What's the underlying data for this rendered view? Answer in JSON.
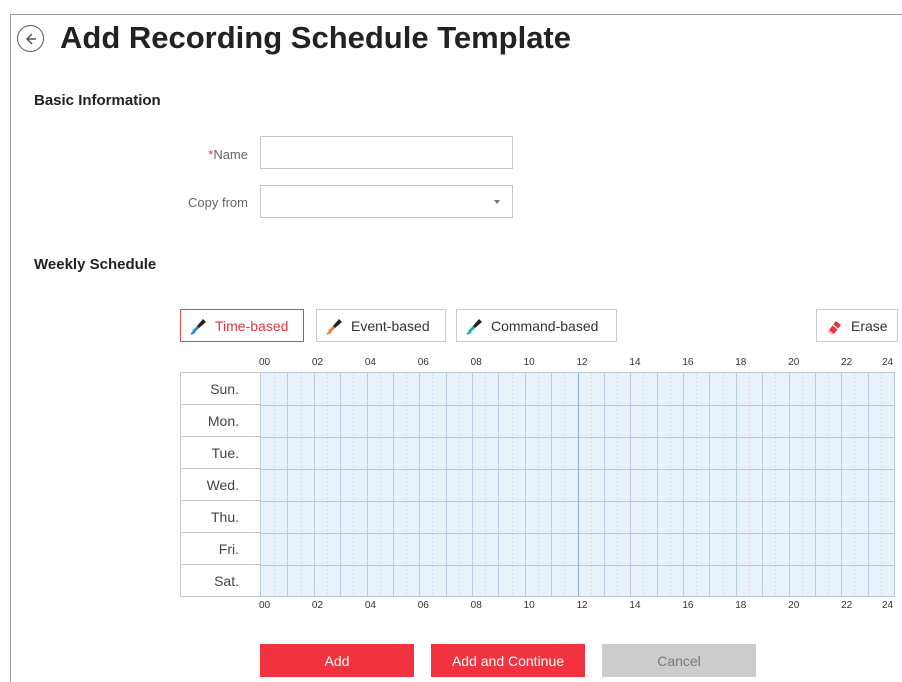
{
  "header": {
    "title": "Add Recording Schedule Template",
    "back_icon": "back-arrow-circle-icon"
  },
  "basic_info": {
    "section_title": "Basic Information",
    "name_required_mark": "*",
    "name_label": "Name",
    "name_value": "",
    "copy_from_label": "Copy from",
    "copy_from_value": ""
  },
  "weekly_schedule": {
    "section_title": "Weekly Schedule",
    "tools": [
      {
        "label": "Time-based",
        "icon": "brush-blue-icon",
        "color": "#1e88c8",
        "active": true
      },
      {
        "label": "Event-based",
        "icon": "brush-orange-icon",
        "color": "#f07a2a",
        "active": false
      },
      {
        "label": "Command-based",
        "icon": "brush-teal-icon",
        "color": "#1fa89a",
        "active": false
      },
      {
        "label": "Erase",
        "icon": "eraser-icon",
        "color": "#e8343f",
        "active": false
      }
    ],
    "hours": [
      "00",
      "02",
      "04",
      "06",
      "08",
      "10",
      "12",
      "14",
      "16",
      "18",
      "20",
      "22",
      "24"
    ],
    "days": [
      "Sun.",
      "Mon.",
      "Tue.",
      "Wed.",
      "Thu.",
      "Fri.",
      "Sat."
    ]
  },
  "actions": {
    "add": "Add",
    "add_continue": "Add and Continue",
    "cancel": "Cancel"
  },
  "colors": {
    "accent": "#f0333e",
    "grid_bg": "#e9f1fb",
    "grid_line": "#b3c8e2"
  }
}
